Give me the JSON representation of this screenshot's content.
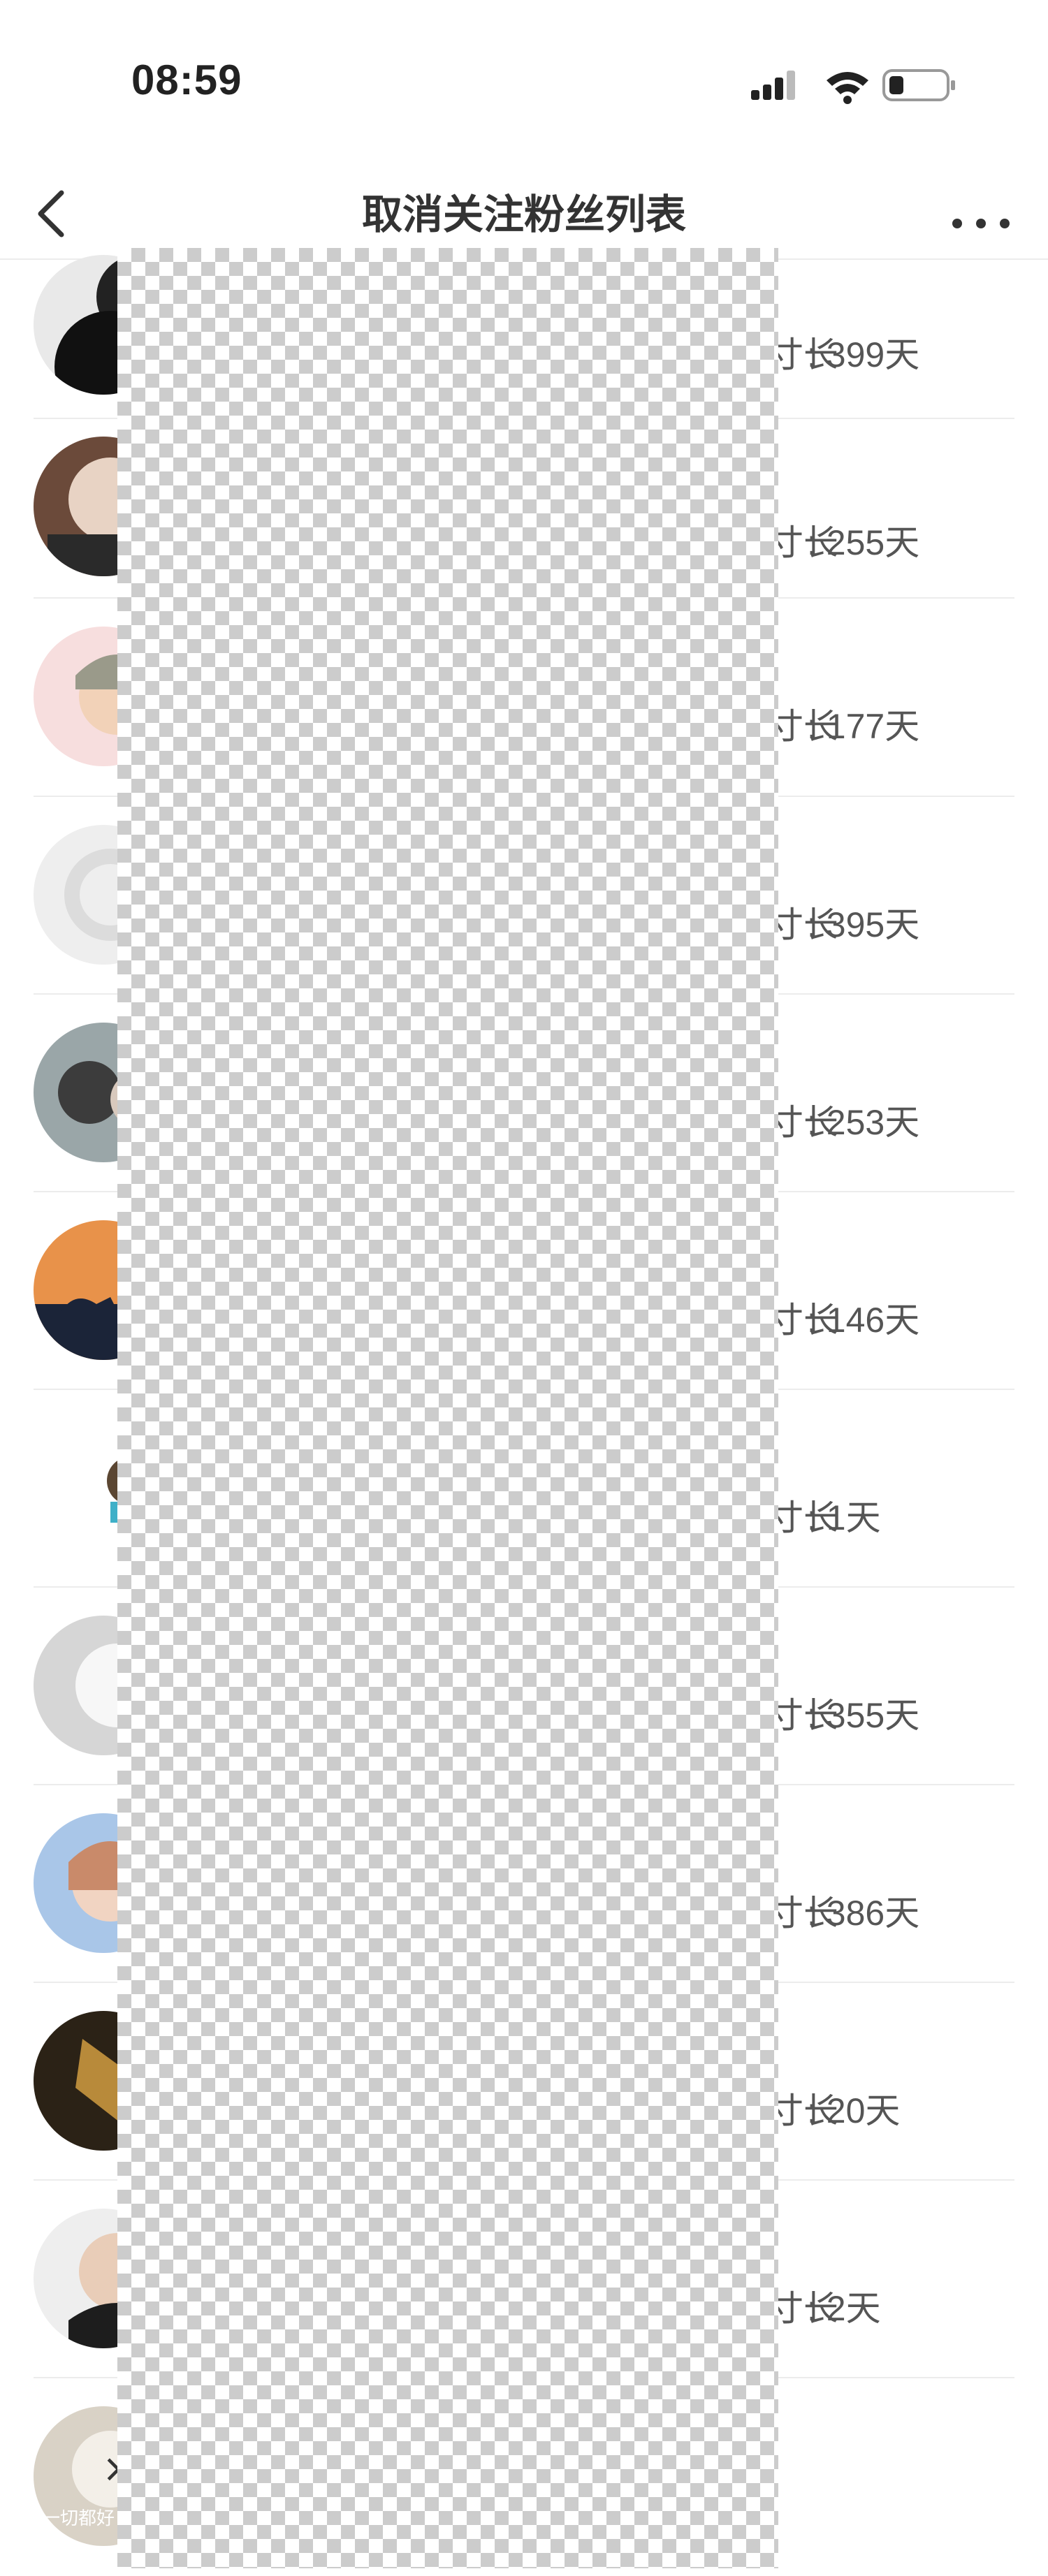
{
  "status_bar": {
    "time": "08:59",
    "icons": [
      "signal-icon",
      "wifi-icon",
      "battery-icon"
    ]
  },
  "nav": {
    "title": "取消关注粉丝列表",
    "back_icon": "chevron-left-icon",
    "more_icon": "more-icon"
  },
  "list": {
    "rows": [
      {
        "prefix": "寸长",
        "value": ": 399天"
      },
      {
        "prefix": "寸长",
        "value": ": 255天"
      },
      {
        "prefix": "寸长",
        "value": ": 177天"
      },
      {
        "prefix": "寸长",
        "value": ": 395天"
      },
      {
        "prefix": "寸长",
        "value": ": 253天"
      },
      {
        "prefix": "寸长",
        "value": ": 146天"
      },
      {
        "prefix": "寸长",
        "value": ": 1天"
      },
      {
        "prefix": "寸长",
        "value": ": 355天"
      },
      {
        "prefix": "寸长",
        "value": ": 386天"
      },
      {
        "prefix": "寸长",
        "value": ": 20天"
      },
      {
        "prefix": "寸长",
        "value": ": 2天"
      },
      {
        "prefix": "",
        "value": ""
      }
    ],
    "last_avatar_caption": "一切都好"
  },
  "colors": {
    "accent": "#222222",
    "separator": "#ececec",
    "redaction_checker": "#cccccc"
  }
}
